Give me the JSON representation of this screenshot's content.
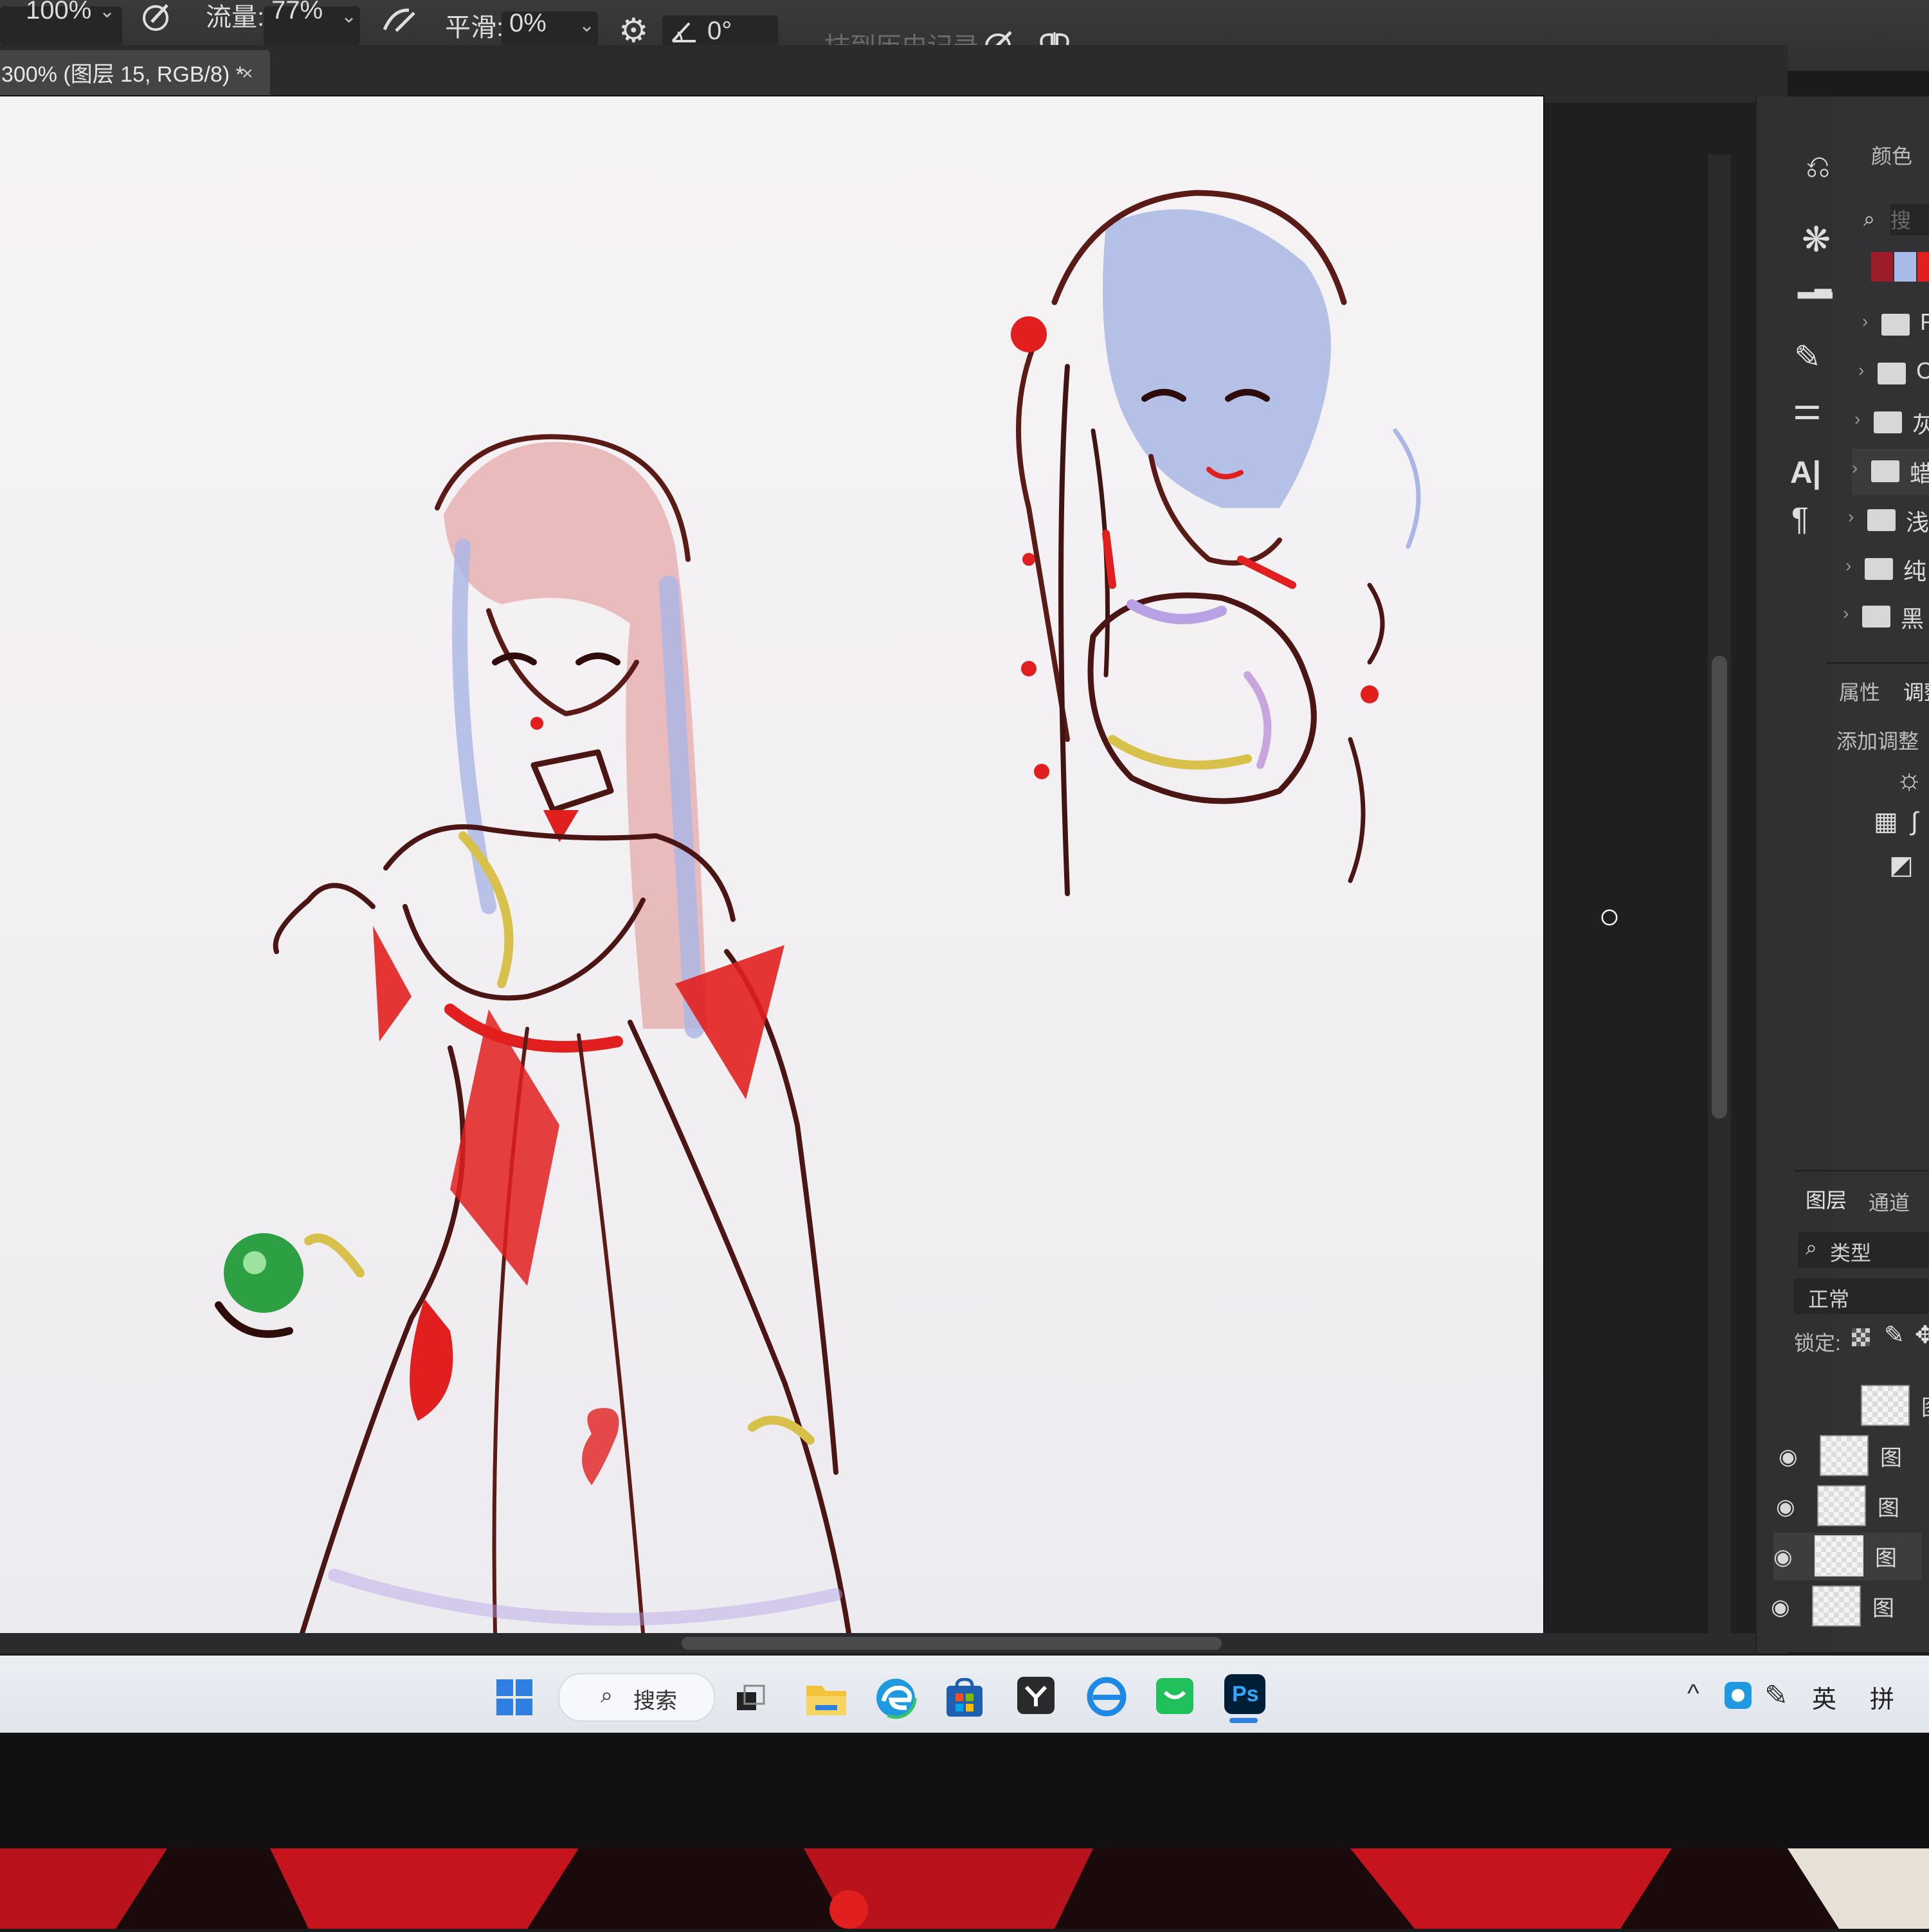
{
  "toolbar": {
    "opacity_value": "100%",
    "flow_label": "流量:",
    "flow_value": "77%",
    "smoothing_label": "平滑:",
    "smoothing_value": "0%",
    "angle_value": "0°",
    "history_label": "抹到历史记录"
  },
  "document_tab": {
    "title": "300% (图层 15, RGB/8) *",
    "close": "×"
  },
  "right_panel": {
    "collapse_glyph": "«",
    "color_tab": "颜色",
    "search_placeholder": "搜索",
    "swatch_folders": [
      "R",
      "C",
      "灰",
      "蜡",
      "浅",
      "纯",
      "黑"
    ],
    "properties_tab": "属性",
    "adjustments_tab": "调整",
    "add_adjustment": "添加调整",
    "layers_tab": "图层",
    "channels_tab": "通道",
    "filter_kind": "类型",
    "blend_mode": "正常",
    "lock_label": "锁定:",
    "layer_names": [
      "图",
      "图",
      "图",
      "图",
      "图"
    ]
  },
  "taskbar": {
    "search_label": "搜索",
    "active_app": "Ps",
    "ime_lang": "英",
    "ime_mode": "拼"
  },
  "colors": {
    "accent_blue": "#2f7fe0",
    "ps_blue": "#31a8ff",
    "ps_bg": "#001e36",
    "sketch_red": "#e21f1f",
    "sketch_brown": "#4a1512",
    "hair_blue": "#a9b6e6",
    "hair_pink": "#e5a3a8"
  }
}
